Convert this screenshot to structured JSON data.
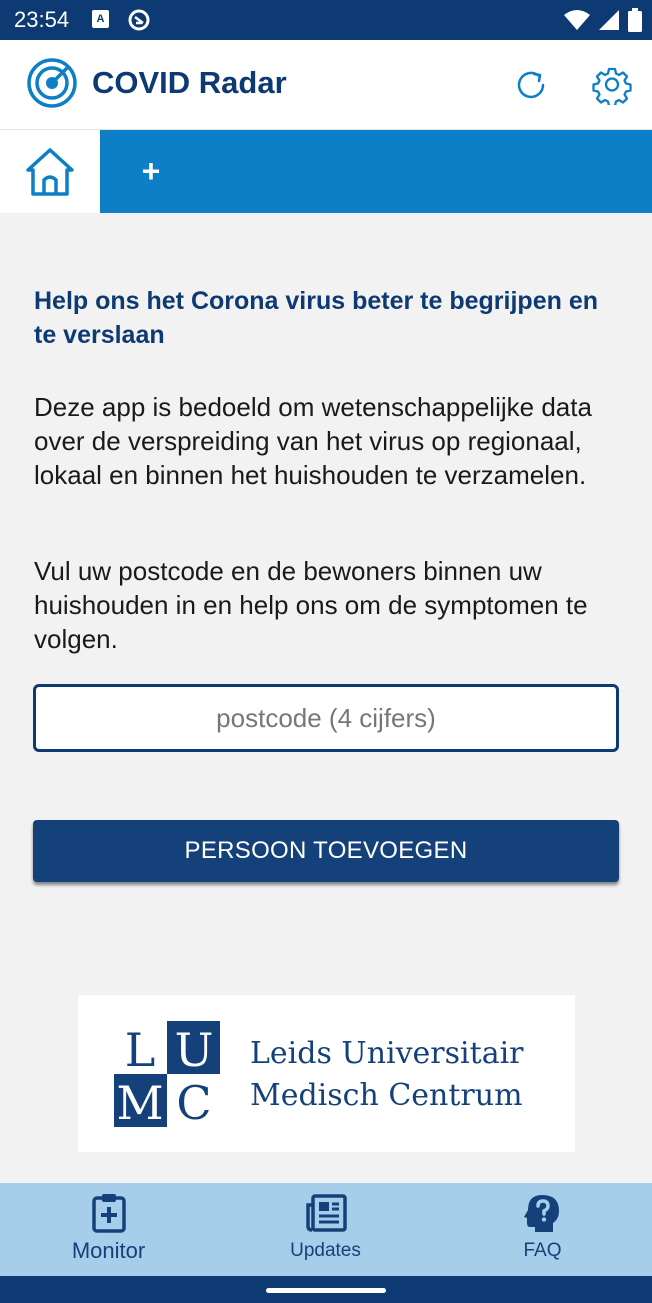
{
  "status_bar": {
    "time": "23:54",
    "notification_letter": "A"
  },
  "app_bar": {
    "title": "COVID Radar",
    "logo_icon": "radar-icon",
    "refresh_icon": "refresh-icon",
    "settings_icon": "gear-icon"
  },
  "tabs": {
    "home_icon": "home-icon",
    "add_label": "+"
  },
  "main": {
    "headline": "Help ons het Corona virus beter te begrijpen en te verslaan",
    "paragraph_1": "Deze app is bedoeld om wetenschappelijke data over de verspreiding van het virus op regionaal, lokaal en binnen het huishouden te verzamelen.",
    "paragraph_2": "Vul uw postcode en de bewoners binnen uw huishouden in en help ons om de symptomen te volgen.",
    "postcode_placeholder": "postcode (4 cijfers)",
    "postcode_value": "",
    "add_person_label": "PERSOON TOEVOEGEN"
  },
  "sponsor": {
    "logo_letters": [
      "L",
      "U",
      "M",
      "C"
    ],
    "name_line_1": "Leids Universitair",
    "name_line_2": "Medisch Centrum"
  },
  "bottom_nav": {
    "items": [
      {
        "label": "Monitor",
        "icon": "clipboard-plus-icon",
        "active": true
      },
      {
        "label": "Updates",
        "icon": "newspaper-icon",
        "active": false
      },
      {
        "label": "FAQ",
        "icon": "head-question-icon",
        "active": false
      }
    ]
  },
  "colors": {
    "primary_dark": "#0d3a72",
    "tab_blue": "#0c7fc7",
    "button_blue": "#15417a",
    "nav_bg": "#a6cdea",
    "page_bg": "#f2f2f2"
  }
}
